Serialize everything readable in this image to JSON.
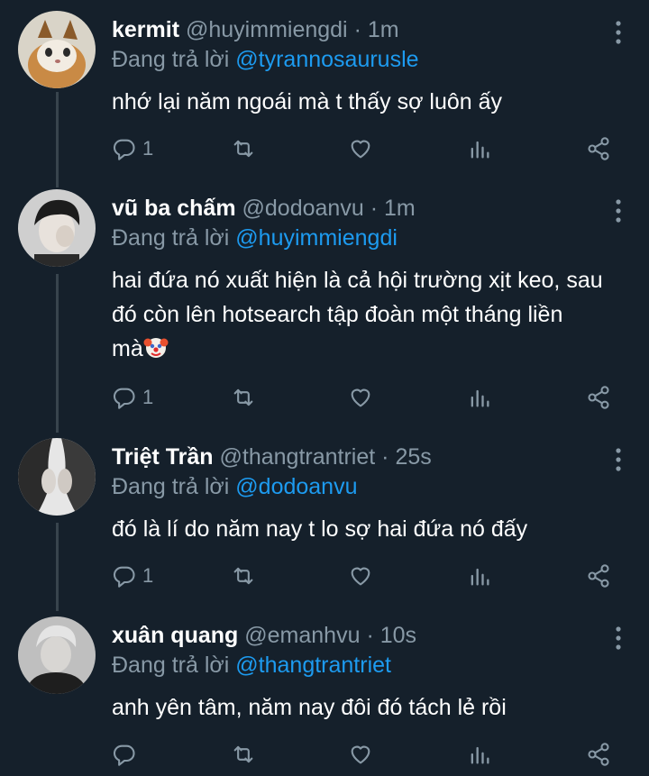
{
  "tweets": [
    {
      "name": "kermit",
      "handle": "@huyimmiengdi",
      "dot": "·",
      "time": "1m",
      "replying_prefix": "Đang trả lời ",
      "replying_to": "@tyrannosaurusle",
      "text": "nhớ lại năm ngoái mà t thấy sợ luôn ấy",
      "reply_count": "1"
    },
    {
      "name": "vũ ba chấm",
      "handle": "@dodoanvu",
      "dot": "·",
      "time": "1m",
      "replying_prefix": "Đang trả lời ",
      "replying_to": "@huyimmiengdi",
      "text_line1": "hai đứa nó xuất hiện là cả hội trường xịt keo, sau",
      "text_line2": "đó còn lên hotsearch tập đoàn một tháng liền",
      "text_line3": "mà",
      "reply_count": "1"
    },
    {
      "name": "Triệt Trần",
      "handle": "@thangtrantriet",
      "dot": "·",
      "time": "25s",
      "replying_prefix": "Đang trả lời ",
      "replying_to": "@dodoanvu",
      "text": "đó là lí do năm nay t lo sợ hai đứa nó đấy",
      "reply_count": "1"
    },
    {
      "name": "xuân quang",
      "handle": "@emanhvu",
      "dot": "·",
      "time": "10s",
      "replying_prefix": "Đang trả lời ",
      "replying_to": "@thangtrantriet",
      "text": "anh yên tâm, năm nay đôi đó tách lẻ rồi",
      "reply_count": ""
    }
  ],
  "icons": [
    "reply-icon",
    "retweet-icon",
    "like-icon",
    "analytics-icon",
    "share-icon",
    "more-icon",
    "clown-emoji"
  ],
  "colors": {
    "background": "#15202b",
    "muted": "#8899a6",
    "link": "#1d9bf0",
    "text": "#ffffff",
    "thread_line": "#38444d"
  }
}
